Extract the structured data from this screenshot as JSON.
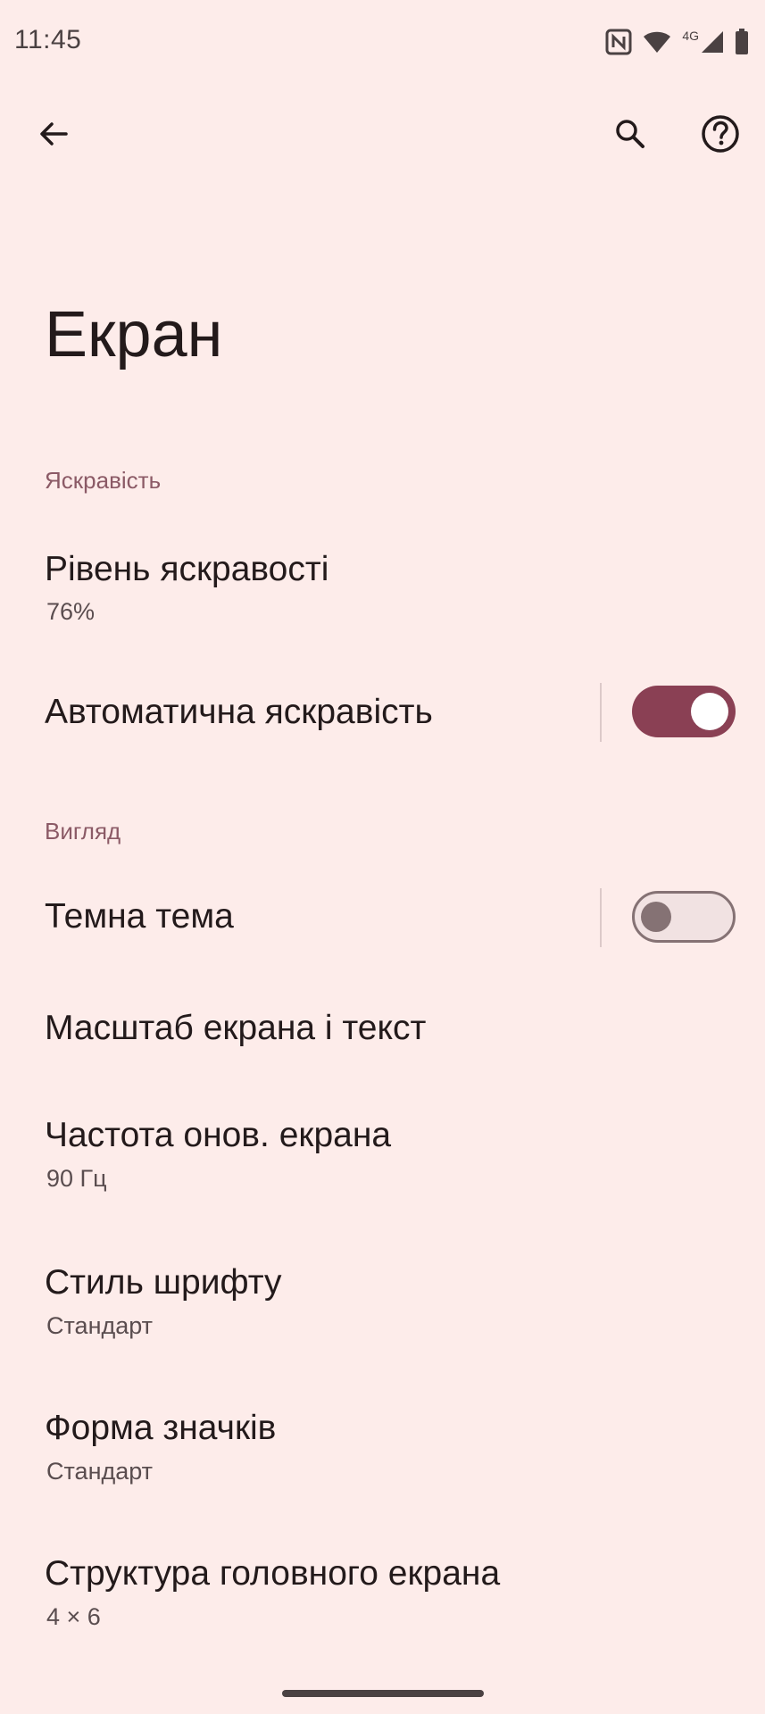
{
  "status_bar": {
    "time": "11:45",
    "network_label": "4G",
    "icons": [
      "nfc-icon",
      "wifi-icon",
      "cellular-signal-icon",
      "battery-icon"
    ]
  },
  "top_bar": {
    "icons": [
      "back-arrow-icon",
      "search-icon",
      "help-icon"
    ]
  },
  "page": {
    "title": "Екран"
  },
  "sections": {
    "brightness": {
      "header": "Яскравість",
      "level_title": "Рівень яскравості",
      "level_value": "76%",
      "auto_title": "Автоматична яскравість",
      "auto_enabled": true
    },
    "appearance": {
      "header": "Вигляд",
      "dark_theme_title": "Темна тема",
      "dark_theme_enabled": false,
      "display_size_title": "Масштаб екрана і текст",
      "refresh_rate_title": "Частота онов. екрана",
      "refresh_rate_value": "90 Гц",
      "font_style_title": "Стиль шрифту",
      "font_style_value": "Стандарт",
      "icon_shape_title": "Форма значків",
      "icon_shape_value": "Стандарт",
      "home_grid_title": "Структура головного екрана",
      "home_grid_value": "4 × 6"
    }
  },
  "colors": {
    "background": "#fdecea",
    "accent": "#8a4054",
    "section_header": "#8b5a66"
  }
}
